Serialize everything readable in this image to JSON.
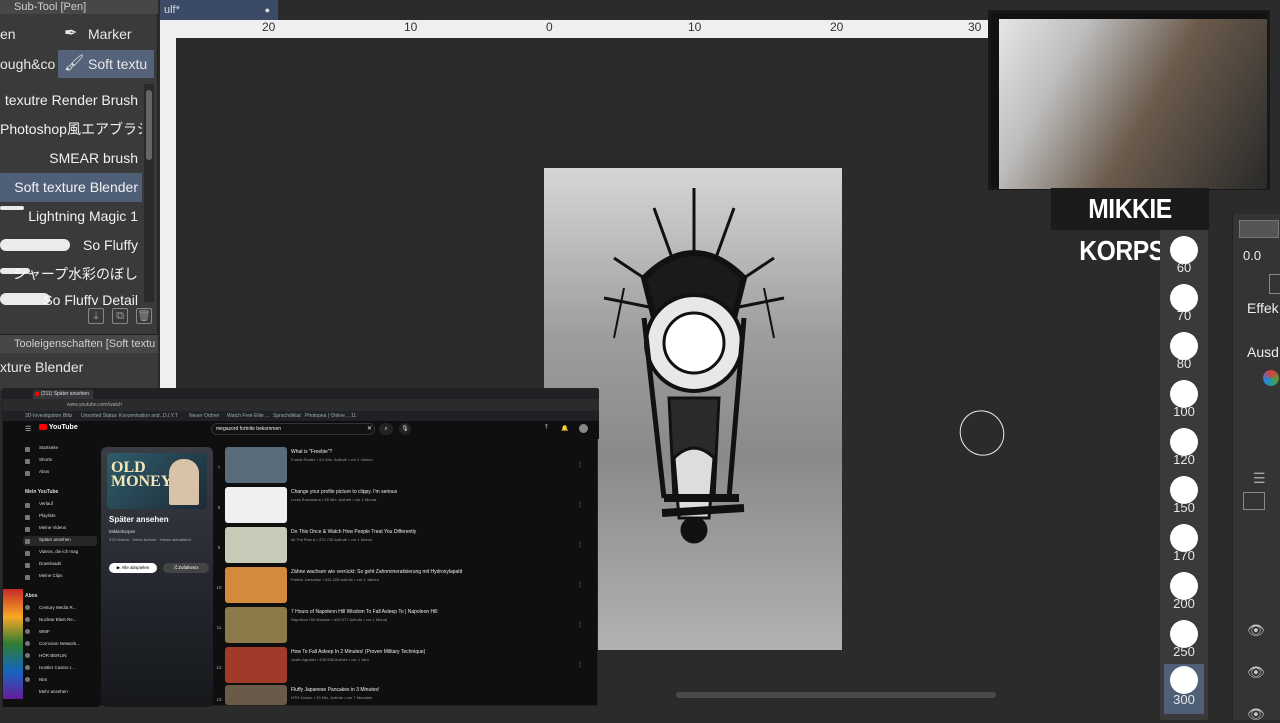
{
  "subtool": {
    "title": "Sub-Tool [Pen]",
    "tabs": [
      {
        "label": "en"
      },
      {
        "label": "Marker"
      },
      {
        "label": "ough&co"
      },
      {
        "label": "Soft textu"
      }
    ],
    "brushes": [
      {
        "label": "texutre Render Brush"
      },
      {
        "label": "Photoshop風エアブラシ"
      },
      {
        "label": "SMEAR brush"
      },
      {
        "label": "Soft texture Blender"
      },
      {
        "label": "Lightning Magic 1"
      },
      {
        "label": "So Fluffy"
      },
      {
        "label": "シャープ水彩のぼし"
      },
      {
        "label": "So Fluffy Detail"
      }
    ],
    "tool_property_title": "Tooleigenschaften [Soft textu",
    "tool_property_name": "xture Blender"
  },
  "canvas": {
    "tab_label": "ulf*",
    "ruler_ticks": [
      "20",
      "10",
      "0",
      "10",
      "20",
      "30"
    ]
  },
  "stream": {
    "name": "MIKKIE KORPSE"
  },
  "brush_sizes": [
    "60",
    "70",
    "80",
    "100",
    "120",
    "150",
    "170",
    "200",
    "250",
    "300"
  ],
  "right_panel": {
    "value": "0.0",
    "effect_label": "Effek",
    "output_label": "Ausd"
  },
  "browser": {
    "tab_label": "(211) Später ansehen",
    "url": "www.youtube.com/watch",
    "bookmarks": [
      "3D-Investigation",
      "Blitz",
      "Unsorted Status",
      "Konzentration and...",
      "D.I.Y.T",
      "Neuer Ordner",
      "Watch Free Elite ...",
      "Sprachdiktat",
      "Photopea | Online ...",
      "11"
    ],
    "search_query": "megazord fortnite bekommen",
    "logo": "YouTube",
    "sidebar": [
      {
        "label": "Startseite"
      },
      {
        "label": "Shorts"
      },
      {
        "label": "Abos"
      },
      {
        "label": "Mein YouTube"
      },
      {
        "label": "Verlauf"
      },
      {
        "label": "Playlists"
      },
      {
        "label": "Meine Videos"
      },
      {
        "label": "Später ansehen"
      },
      {
        "label": "Videos, die ich mag"
      },
      {
        "label": "Downloads"
      },
      {
        "label": "Meine Clips"
      },
      {
        "label": "Abos"
      },
      {
        "label": "Century Media R..."
      },
      {
        "label": "Nuclear Blast Re..."
      },
      {
        "label": "WMF"
      },
      {
        "label": "Corrosion Network..."
      },
      {
        "label": "HÖR BERLIN"
      },
      {
        "label": "Hostler Casino I..."
      },
      {
        "label": "Ntm"
      },
      {
        "label": "Mehr ansehen"
      }
    ],
    "playlist": {
      "thumb_text": "OLD MONEY",
      "title": "Später ansehen",
      "owner": "Mikkiekorpse",
      "meta": "375 Videos · Keine Aufrufe · Heute aktualisiert",
      "play_all": "Alle abspielen",
      "shuffle": "Zufallsmix"
    },
    "videos": [
      {
        "index": "7",
        "title": "What is \"Freebie\"?",
        "meta": "Forest Rodier • 3,0 Mio. Aufrufe • vor 2 Jahren",
        "thumb": "#5a6b7a"
      },
      {
        "index": "8",
        "title": "Change your profile picture to clippy. I'm serious",
        "meta": "Louis Rossmann • 99 Mio. Aufrufe • vor 1 Monat",
        "thumb": "#f0f0f0"
      },
      {
        "index": "9",
        "title": "Do This Once & Watch How People Treat You Differently",
        "meta": "Mr Pat Plan A • 370.735 Aufrufe • vor 1 Monat",
        "thumb": "#c9c9b8"
      },
      {
        "index": "10",
        "title": "Zähne wachsen wie verrückt: So geht Zahnmineralisierung mit Hydroxylapatit",
        "meta": "Patrick Jaeschke • 631.328 Aufrufe • vor 2 Jahren",
        "thumb": "#d38a3a"
      },
      {
        "index": "11",
        "title": "7 Hours of Napoleon Hill Wisdom To Fall Asleep To | Napoleon Hill",
        "meta": "Napoleon Hill Wisdom • 409.977 Aufrufe • vor 1 Monat",
        "thumb": "#8c7a4a"
      },
      {
        "index": "12",
        "title": "How To Fall Asleep In 2 Minutes! (Proven Military Technique)",
        "meta": "Justin Agustin • 339.938 Aufrufe • vor 1 Jahr",
        "thumb": "#a23a2a"
      },
      {
        "index": "13",
        "title": "Fluffy Japanese Pancakes in 3 Minutes!",
        "meta": "HTH Zucker • 13 Mio. Aufrufe • vor 7 Monaten",
        "thumb": "#6a5a4a"
      }
    ]
  }
}
